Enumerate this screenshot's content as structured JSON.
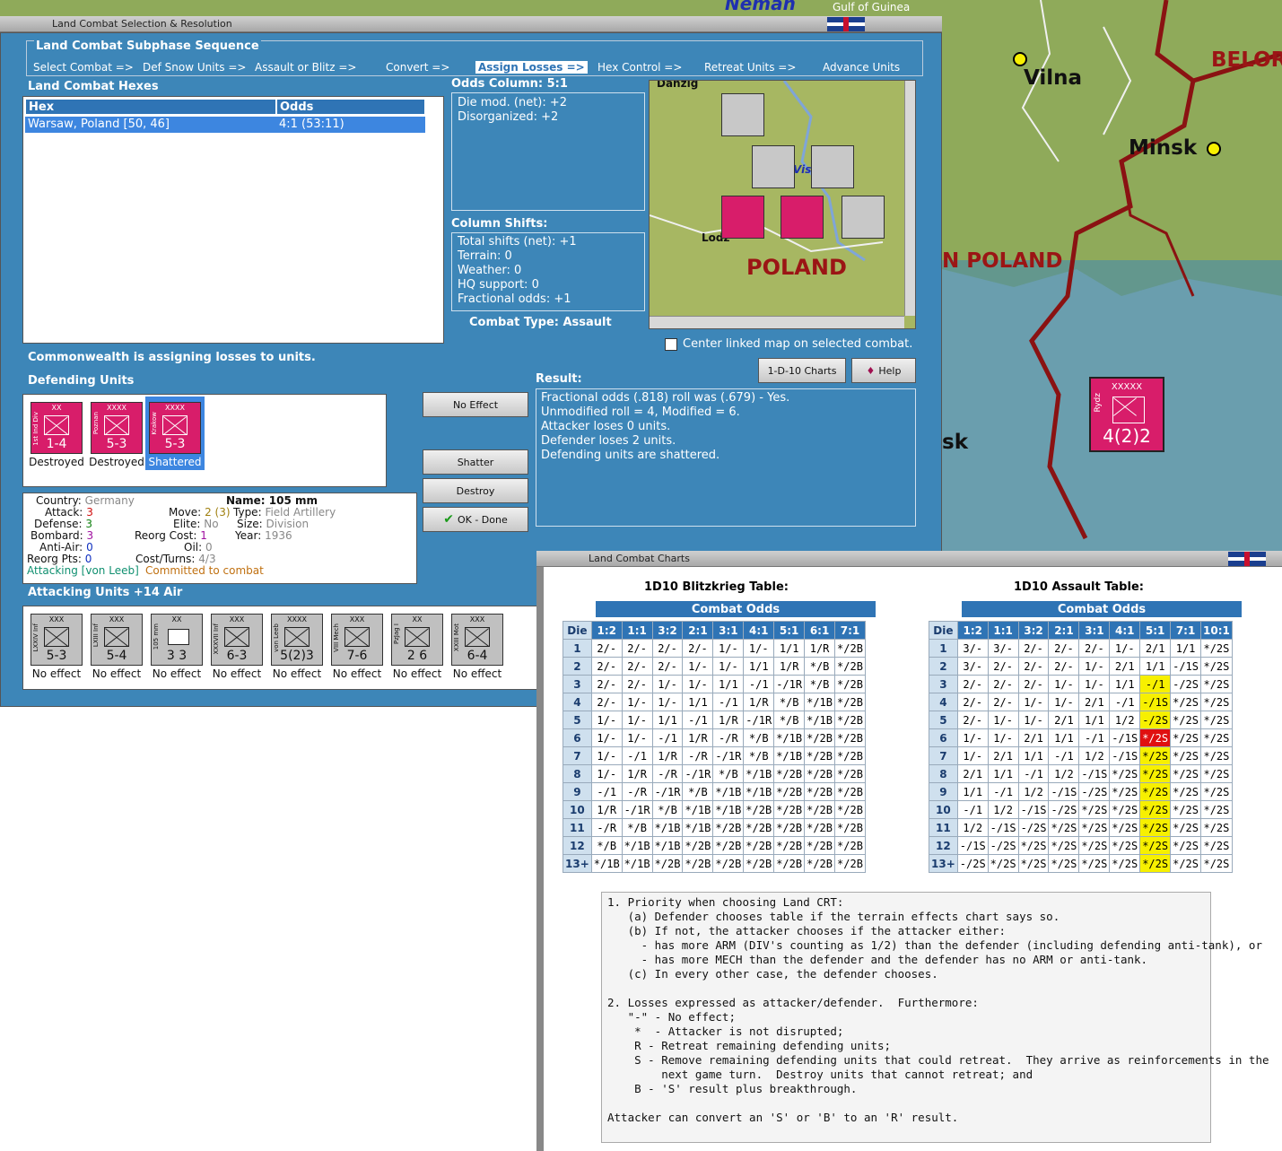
{
  "map": {
    "labels": [
      {
        "text": "Neman"
      },
      {
        "text": "Gulf of Guinea"
      },
      {
        "text": "Vilna"
      },
      {
        "text": "Minsk"
      },
      {
        "text": "BELOR"
      },
      {
        "text": "N POLAND"
      },
      {
        "text": "sk"
      }
    ],
    "unit": {
      "size": "XXXXX",
      "name": "Rydz",
      "value": "4(2)2",
      "side": "POL"
    }
  },
  "combat_window": {
    "title": "Land Combat Selection & Resolution",
    "sequence_title": "Land Combat Subphase Sequence",
    "sequence": [
      {
        "label": "Select Combat =>"
      },
      {
        "label": "Def Snow Units =>"
      },
      {
        "label": "Assault or Blitz =>"
      },
      {
        "label": "Convert =>"
      },
      {
        "label": "Assign Losses =>",
        "active": true
      },
      {
        "label": "Hex Control =>"
      },
      {
        "label": "Retreat Units =>"
      },
      {
        "label": "Advance Units"
      }
    ],
    "hexes_title": "Land Combat Hexes",
    "hexes_headers": [
      "Hex",
      "Odds"
    ],
    "hexes_rows": [
      [
        "Warsaw, Poland [50, 46]",
        "4:1 (53:11)"
      ]
    ],
    "odds_column": "Odds Column: 5:1",
    "die_mod": "Die mod. (net): +2",
    "disorganized": "Disorganized: +2",
    "column_shifts_title": "Column Shifts:",
    "shifts": [
      "Total shifts (net): +1",
      "Terrain: 0",
      "Weather: 0",
      "HQ support: 0",
      "Fractional odds: +1"
    ],
    "combat_type": "Combat Type:  Assault",
    "minimap": {
      "label": "POLAND",
      "city": "Danzig",
      "city2": "Lodz",
      "river": "Vistula"
    },
    "center_linked": "Center linked map on selected combat.",
    "charts_button": "1-D-10 Charts",
    "help_button": "Help",
    "status": "Commonwealth is assigning losses to units.",
    "defending_title": "Defending Units",
    "defenders": [
      {
        "size": "XX",
        "name": "1st Ind Div",
        "value": "1-4",
        "status": "Destroyed"
      },
      {
        "size": "XXXX",
        "name": "Poznan",
        "value": "5-3",
        "status": "Destroyed"
      },
      {
        "size": "XXXX",
        "name": "Krakow",
        "value": "5-3",
        "status": "Shattered",
        "selected": true
      }
    ],
    "result_title": "Result:",
    "result_lines": [
      "Fractional odds (.818) roll was (.679)  - Yes.",
      "Unmodified roll = 4, Modified = 6.",
      "Attacker loses 0 units.",
      "Defender loses 2 units.",
      "Defending units are shattered."
    ],
    "buttons": {
      "no_effect": "No Effect",
      "shatter": "Shatter",
      "destroy": "Destroy",
      "ok": "OK - Done"
    },
    "details": {
      "country_label": "Country:",
      "country": "Germany",
      "attack_label": "Attack:",
      "attack": "3",
      "defense_label": "Defense:",
      "defense": "3",
      "bombard_label": "Bombard:",
      "bombard": "3",
      "antiair_label": "Anti-Air:",
      "antiair": "0",
      "reorg_pts_label": "Reorg Pts:",
      "reorg_pts": "0",
      "move_label": "Move:",
      "move": "2 (3)",
      "elite_label": "Elite:",
      "elite": "No",
      "reorg_cost_label": "Reorg Cost:",
      "reorg_cost": "1",
      "oil_label": "Oil:",
      "oil": "0",
      "cost_label": "Cost/Turns:",
      "cost": "4/3",
      "name_label": "Name:",
      "name": "105 mm",
      "type_label": "Type:",
      "type": "Field Artillery",
      "size_label": "Size:",
      "size": "Division",
      "year_label": "Year:",
      "year": "1936",
      "attacking_label": "Attacking [von Leeb]",
      "committed": "Committed to combat"
    },
    "attacking_title": "Attacking Units +14 Air",
    "attackers": [
      {
        "size": "XXX",
        "name": "LXXIV Inf",
        "value": "5-3",
        "status": "No effect"
      },
      {
        "size": "XXX",
        "name": "LXIII Inf",
        "value": "5-4",
        "status": "No effect"
      },
      {
        "size": "XX",
        "name": "105 mm",
        "value": "3 3",
        "status": "No effect"
      },
      {
        "size": "XXX",
        "name": "XXXVII Inf",
        "value": "6-3",
        "status": "No effect"
      },
      {
        "size": "XXXX",
        "name": "von Leeb",
        "value": "5(2)3",
        "status": "No effect"
      },
      {
        "size": "XXX",
        "name": "VIII Mech",
        "value": "7-6",
        "status": "No effect"
      },
      {
        "size": "XX",
        "name": "PzJag I",
        "value": "2 6",
        "status": "No effect"
      },
      {
        "size": "XXX",
        "name": "XXIII Mot",
        "value": "6-4",
        "status": "No effect"
      }
    ]
  },
  "charts_window": {
    "title": "Land Combat Charts",
    "blitz_title": "1D10 Blitzkrieg Table:",
    "assault_title": "1D10 Assault Table:",
    "combat_odds": "Combat Odds",
    "die_label": "Die",
    "blitz_odds": [
      "1:2",
      "1:1",
      "3:2",
      "2:1",
      "3:1",
      "4:1",
      "5:1",
      "6:1",
      "7:1"
    ],
    "assault_odds": [
      "1:2",
      "1:1",
      "3:2",
      "2:1",
      "3:1",
      "4:1",
      "5:1",
      "7:1",
      "10:1"
    ],
    "dice": [
      "1",
      "2",
      "3",
      "4",
      "5",
      "6",
      "7",
      "8",
      "9",
      "10",
      "11",
      "12",
      "13+"
    ],
    "blitz_rows": [
      [
        "2/-",
        "2/-",
        "2/-",
        "2/-",
        "1/-",
        "1/-",
        "1/1",
        "1/R",
        "*/2B"
      ],
      [
        "2/-",
        "2/-",
        "2/-",
        "1/-",
        "1/-",
        "1/1",
        "1/R",
        "*/B",
        "*/2B"
      ],
      [
        "2/-",
        "2/-",
        "1/-",
        "1/-",
        "1/1",
        "-/1",
        "-/1R",
        "*/B",
        "*/2B"
      ],
      [
        "2/-",
        "1/-",
        "1/-",
        "1/1",
        "-/1",
        "1/R",
        "*/B",
        "*/1B",
        "*/2B"
      ],
      [
        "1/-",
        "1/-",
        "1/1",
        "-/1",
        "1/R",
        "-/1R",
        "*/B",
        "*/1B",
        "*/2B"
      ],
      [
        "1/-",
        "1/-",
        "-/1",
        "1/R",
        "-/R",
        "*/B",
        "*/1B",
        "*/2B",
        "*/2B"
      ],
      [
        "1/-",
        "-/1",
        "1/R",
        "-/R",
        "-/1R",
        "*/B",
        "*/1B",
        "*/2B",
        "*/2B"
      ],
      [
        "1/-",
        "1/R",
        "-/R",
        "-/1R",
        "*/B",
        "*/1B",
        "*/2B",
        "*/2B",
        "*/2B"
      ],
      [
        "-/1",
        "-/R",
        "-/1R",
        "*/B",
        "*/1B",
        "*/1B",
        "*/2B",
        "*/2B",
        "*/2B"
      ],
      [
        "1/R",
        "-/1R",
        "*/B",
        "*/1B",
        "*/1B",
        "*/2B",
        "*/2B",
        "*/2B",
        "*/2B"
      ],
      [
        "-/R",
        "*/B",
        "*/1B",
        "*/1B",
        "*/2B",
        "*/2B",
        "*/2B",
        "*/2B",
        "*/2B"
      ],
      [
        "*/B",
        "*/1B",
        "*/1B",
        "*/2B",
        "*/2B",
        "*/2B",
        "*/2B",
        "*/2B",
        "*/2B"
      ],
      [
        "*/1B",
        "*/1B",
        "*/2B",
        "*/2B",
        "*/2B",
        "*/2B",
        "*/2B",
        "*/2B",
        "*/2B"
      ]
    ],
    "assault_rows": [
      [
        "3/-",
        "3/-",
        "2/-",
        "2/-",
        "2/-",
        "1/-",
        "2/1",
        "1/1",
        "*/2S"
      ],
      [
        "3/-",
        "2/-",
        "2/-",
        "2/-",
        "1/-",
        "2/1",
        "1/1",
        "-/1S",
        "*/2S"
      ],
      [
        "2/-",
        "2/-",
        "2/-",
        "1/-",
        "1/-",
        "1/1",
        "-/1",
        "-/2S",
        "*/2S"
      ],
      [
        "2/-",
        "2/-",
        "1/-",
        "1/-",
        "2/1",
        "-/1",
        "-/1S",
        "*/2S",
        "*/2S"
      ],
      [
        "2/-",
        "1/-",
        "1/-",
        "2/1",
        "1/1",
        "1/2",
        "-/2S",
        "*/2S",
        "*/2S"
      ],
      [
        "1/-",
        "1/-",
        "2/1",
        "1/1",
        "-/1",
        "-/1S",
        "*/2S",
        "*/2S",
        "*/2S"
      ],
      [
        "1/-",
        "2/1",
        "1/1",
        "-/1",
        "1/2",
        "-/1S",
        "*/2S",
        "*/2S",
        "*/2S"
      ],
      [
        "2/1",
        "1/1",
        "-/1",
        "1/2",
        "-/1S",
        "*/2S",
        "*/2S",
        "*/2S",
        "*/2S"
      ],
      [
        "1/1",
        "-/1",
        "1/2",
        "-/1S",
        "-/2S",
        "*/2S",
        "*/2S",
        "*/2S",
        "*/2S"
      ],
      [
        "-/1",
        "1/2",
        "-/1S",
        "-/2S",
        "*/2S",
        "*/2S",
        "*/2S",
        "*/2S",
        "*/2S"
      ],
      [
        "1/2",
        "-/1S",
        "-/2S",
        "*/2S",
        "*/2S",
        "*/2S",
        "*/2S",
        "*/2S",
        "*/2S"
      ],
      [
        "-/1S",
        "-/2S",
        "*/2S",
        "*/2S",
        "*/2S",
        "*/2S",
        "*/2S",
        "*/2S",
        "*/2S"
      ],
      [
        "-/2S",
        "*/2S",
        "*/2S",
        "*/2S",
        "*/2S",
        "*/2S",
        "*/2S",
        "*/2S",
        "*/2S"
      ]
    ],
    "highlight_colors": {
      "column": "#f7f000",
      "result": "#e01010"
    },
    "notes": [
      "1. Priority when choosing Land CRT:",
      "   (a) Defender chooses table if the terrain effects chart says so.",
      "   (b) If not, the attacker chooses if the attacker either:",
      "     - has more ARM (DIV's counting as 1/2) than the defender (including defending anti-tank), or",
      "     - has more MECH than the defender and the defender has no ARM or anti-tank.",
      "   (c) In every other case, the defender chooses.",
      "",
      "2. Losses expressed as attacker/defender.  Furthermore:",
      "   \"-\" - No effect;",
      "    *  - Attacker is not disrupted;",
      "    R - Retreat remaining defending units;",
      "    S - Remove remaining defending units that could retreat.  They arrive as reinforcements in the",
      "        next game turn.  Destroy units that cannot retreat; and",
      "    B - 'S' result plus breakthrough.",
      "",
      "Attacker can convert an 'S' or 'B' to an 'R' result."
    ]
  }
}
